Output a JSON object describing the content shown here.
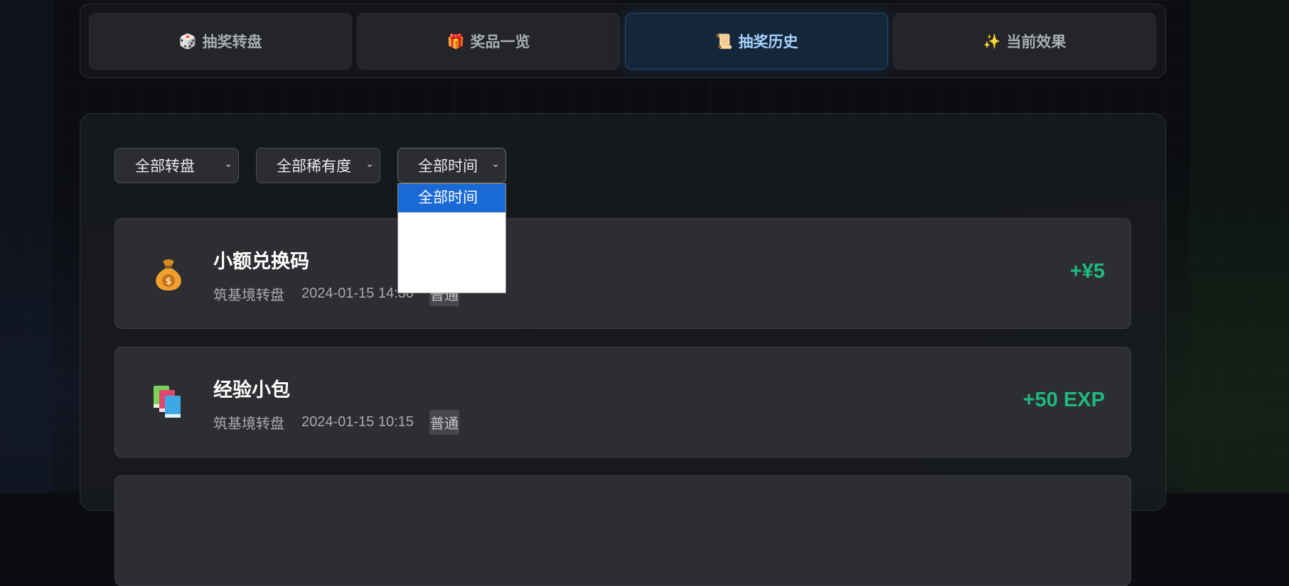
{
  "tabs": [
    {
      "label": "抽奖转盘",
      "icon": "🎲",
      "icon_name": "dice-icon",
      "active": false
    },
    {
      "label": "奖品一览",
      "icon": "🎁",
      "icon_name": "gift-icon",
      "active": false
    },
    {
      "label": "抽奖历史",
      "icon": "📜",
      "icon_name": "scroll-icon",
      "active": true
    },
    {
      "label": "当前效果",
      "icon": "✨",
      "icon_name": "sparkles-icon",
      "active": false
    }
  ],
  "filters": {
    "wheel": {
      "value": "全部转盘"
    },
    "rarity": {
      "value": "全部稀有度"
    },
    "time": {
      "value": "全部时间",
      "open": true,
      "options": [
        "全部时间"
      ]
    }
  },
  "history": [
    {
      "name": "小额兑换码",
      "wheel": "筑基境转盘",
      "time": "2024-01-15 14:30",
      "rarity": "普通",
      "reward": "+¥5",
      "icon": "money-bag-icon"
    },
    {
      "name": "经验小包",
      "wheel": "筑基境转盘",
      "time": "2024-01-15 10:15",
      "rarity": "普通",
      "reward": "+50 EXP",
      "icon": "books-icon"
    }
  ],
  "colors": {
    "accent": "#1a6ad6",
    "reward": "#1fb882",
    "active_tab": "#a9d2ff"
  }
}
